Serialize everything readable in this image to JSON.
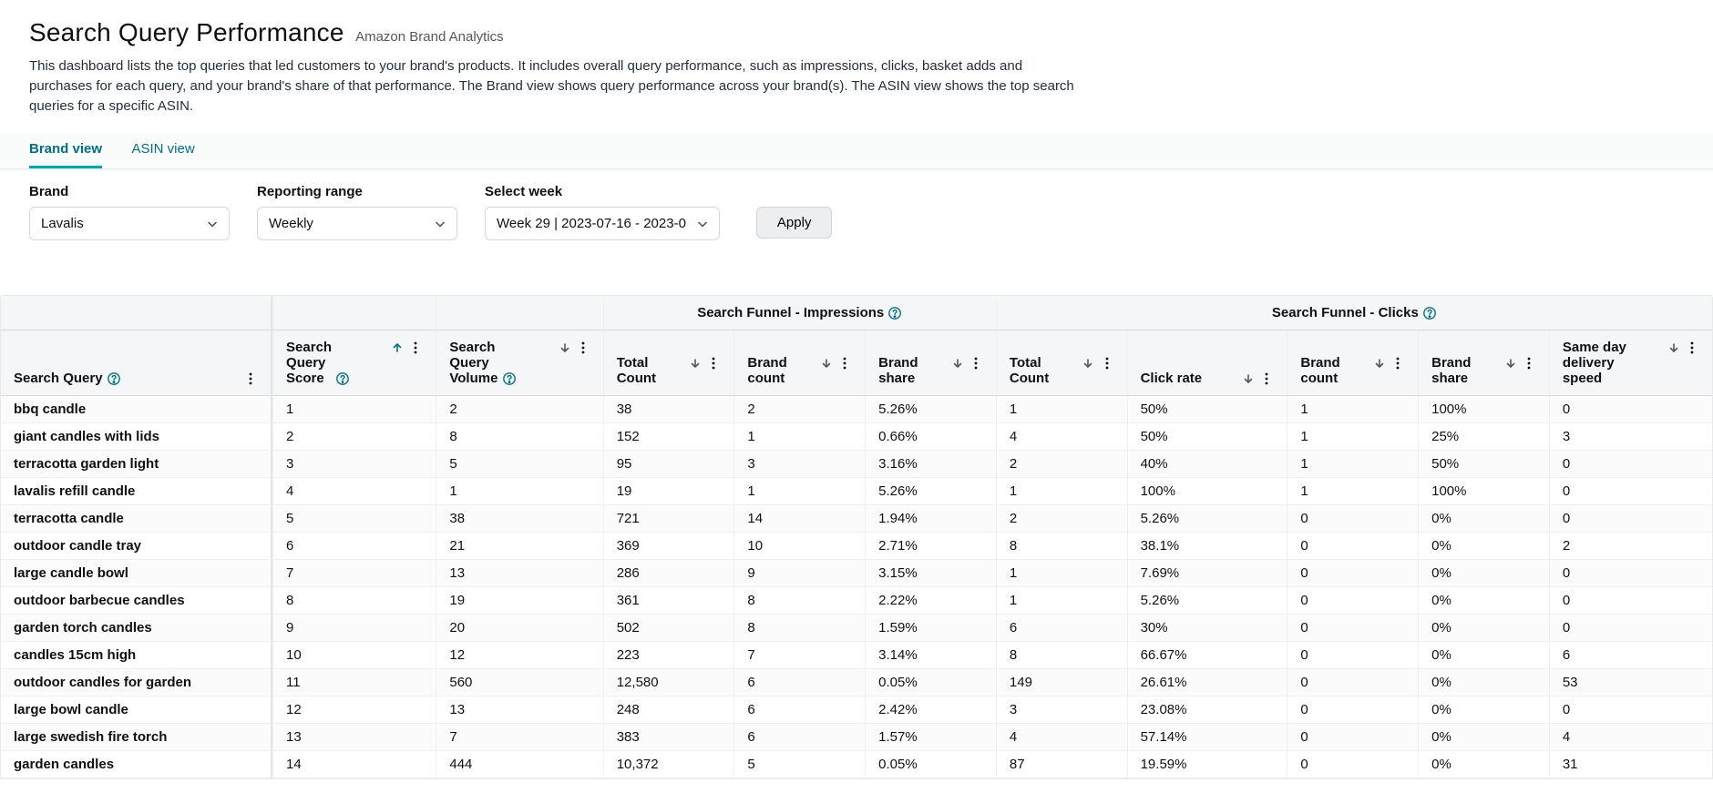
{
  "header": {
    "title": "Search Query Performance",
    "subtitle": "Amazon Brand Analytics",
    "description": "This dashboard lists the top queries that led customers to your brand's products. It includes overall query performance, such as impressions, clicks, basket adds and purchases for each query, and your brand's share of that performance. The Brand view shows query performance across your brand(s). The ASIN view shows the top search queries for a specific ASIN."
  },
  "tabs": {
    "brand": "Brand view",
    "asin": "ASIN view"
  },
  "filters": {
    "brand_label": "Brand",
    "brand_value": "Lavalis",
    "range_label": "Reporting range",
    "range_value": "Weekly",
    "week_label": "Select week",
    "week_value": "Week 29 | 2023-07-16 - 2023-0",
    "apply": "Apply"
  },
  "table": {
    "group_impressions": "Search Funnel - Impressions",
    "group_clicks": "Search Funnel - Clicks",
    "cols": {
      "query": "Search Query",
      "score_l1": "Search",
      "score_l2": "Query",
      "score_l3": "Score",
      "vol_l1": "Search",
      "vol_l2": "Query",
      "vol_l3": "Volume",
      "i_tot_l1": "Total",
      "i_tot_l2": "Count",
      "i_bc_l1": "Brand",
      "i_bc_l2": "count",
      "i_bs_l1": "Brand",
      "i_bs_l2": "share",
      "c_tot_l1": "Total",
      "c_tot_l2": "Count",
      "c_rate": "Click rate",
      "c_bc_l1": "Brand",
      "c_bc_l2": "count",
      "c_bs_l1": "Brand",
      "c_bs_l2": "share",
      "sdd_l1": "Same day",
      "sdd_l2": "delivery",
      "sdd_l3": "speed"
    },
    "rows": [
      {
        "q": "bbq candle",
        "score": "1",
        "vol": "2",
        "itot": "38",
        "ibc": "2",
        "ibs": "5.26%",
        "ctot": "1",
        "crate": "50%",
        "cbc": "1",
        "cbs": "100%",
        "sdd": "0"
      },
      {
        "q": "giant candles with lids",
        "score": "2",
        "vol": "8",
        "itot": "152",
        "ibc": "1",
        "ibs": "0.66%",
        "ctot": "4",
        "crate": "50%",
        "cbc": "1",
        "cbs": "25%",
        "sdd": "3"
      },
      {
        "q": "terracotta garden light",
        "score": "3",
        "vol": "5",
        "itot": "95",
        "ibc": "3",
        "ibs": "3.16%",
        "ctot": "2",
        "crate": "40%",
        "cbc": "1",
        "cbs": "50%",
        "sdd": "0"
      },
      {
        "q": "lavalis refill candle",
        "score": "4",
        "vol": "1",
        "itot": "19",
        "ibc": "1",
        "ibs": "5.26%",
        "ctot": "1",
        "crate": "100%",
        "cbc": "1",
        "cbs": "100%",
        "sdd": "0"
      },
      {
        "q": "terracotta candle",
        "score": "5",
        "vol": "38",
        "itot": "721",
        "ibc": "14",
        "ibs": "1.94%",
        "ctot": "2",
        "crate": "5.26%",
        "cbc": "0",
        "cbs": "0%",
        "sdd": "0"
      },
      {
        "q": "outdoor candle tray",
        "score": "6",
        "vol": "21",
        "itot": "369",
        "ibc": "10",
        "ibs": "2.71%",
        "ctot": "8",
        "crate": "38.1%",
        "cbc": "0",
        "cbs": "0%",
        "sdd": "2"
      },
      {
        "q": "large candle bowl",
        "score": "7",
        "vol": "13",
        "itot": "286",
        "ibc": "9",
        "ibs": "3.15%",
        "ctot": "1",
        "crate": "7.69%",
        "cbc": "0",
        "cbs": "0%",
        "sdd": "0"
      },
      {
        "q": "outdoor barbecue candles",
        "score": "8",
        "vol": "19",
        "itot": "361",
        "ibc": "8",
        "ibs": "2.22%",
        "ctot": "1",
        "crate": "5.26%",
        "cbc": "0",
        "cbs": "0%",
        "sdd": "0"
      },
      {
        "q": "garden torch candles",
        "score": "9",
        "vol": "20",
        "itot": "502",
        "ibc": "8",
        "ibs": "1.59%",
        "ctot": "6",
        "crate": "30%",
        "cbc": "0",
        "cbs": "0%",
        "sdd": "0"
      },
      {
        "q": "candles 15cm high",
        "score": "10",
        "vol": "12",
        "itot": "223",
        "ibc": "7",
        "ibs": "3.14%",
        "ctot": "8",
        "crate": "66.67%",
        "cbc": "0",
        "cbs": "0%",
        "sdd": "6"
      },
      {
        "q": "outdoor candles for garden",
        "score": "11",
        "vol": "560",
        "itot": "12,580",
        "ibc": "6",
        "ibs": "0.05%",
        "ctot": "149",
        "crate": "26.61%",
        "cbc": "0",
        "cbs": "0%",
        "sdd": "53"
      },
      {
        "q": "large bowl candle",
        "score": "12",
        "vol": "13",
        "itot": "248",
        "ibc": "6",
        "ibs": "2.42%",
        "ctot": "3",
        "crate": "23.08%",
        "cbc": "0",
        "cbs": "0%",
        "sdd": "0"
      },
      {
        "q": "large swedish fire torch",
        "score": "13",
        "vol": "7",
        "itot": "383",
        "ibc": "6",
        "ibs": "1.57%",
        "ctot": "4",
        "crate": "57.14%",
        "cbc": "0",
        "cbs": "0%",
        "sdd": "4"
      },
      {
        "q": "garden candles",
        "score": "14",
        "vol": "444",
        "itot": "10,372",
        "ibc": "5",
        "ibs": "0.05%",
        "ctot": "87",
        "crate": "19.59%",
        "cbc": "0",
        "cbs": "0%",
        "sdd": "31"
      }
    ]
  }
}
